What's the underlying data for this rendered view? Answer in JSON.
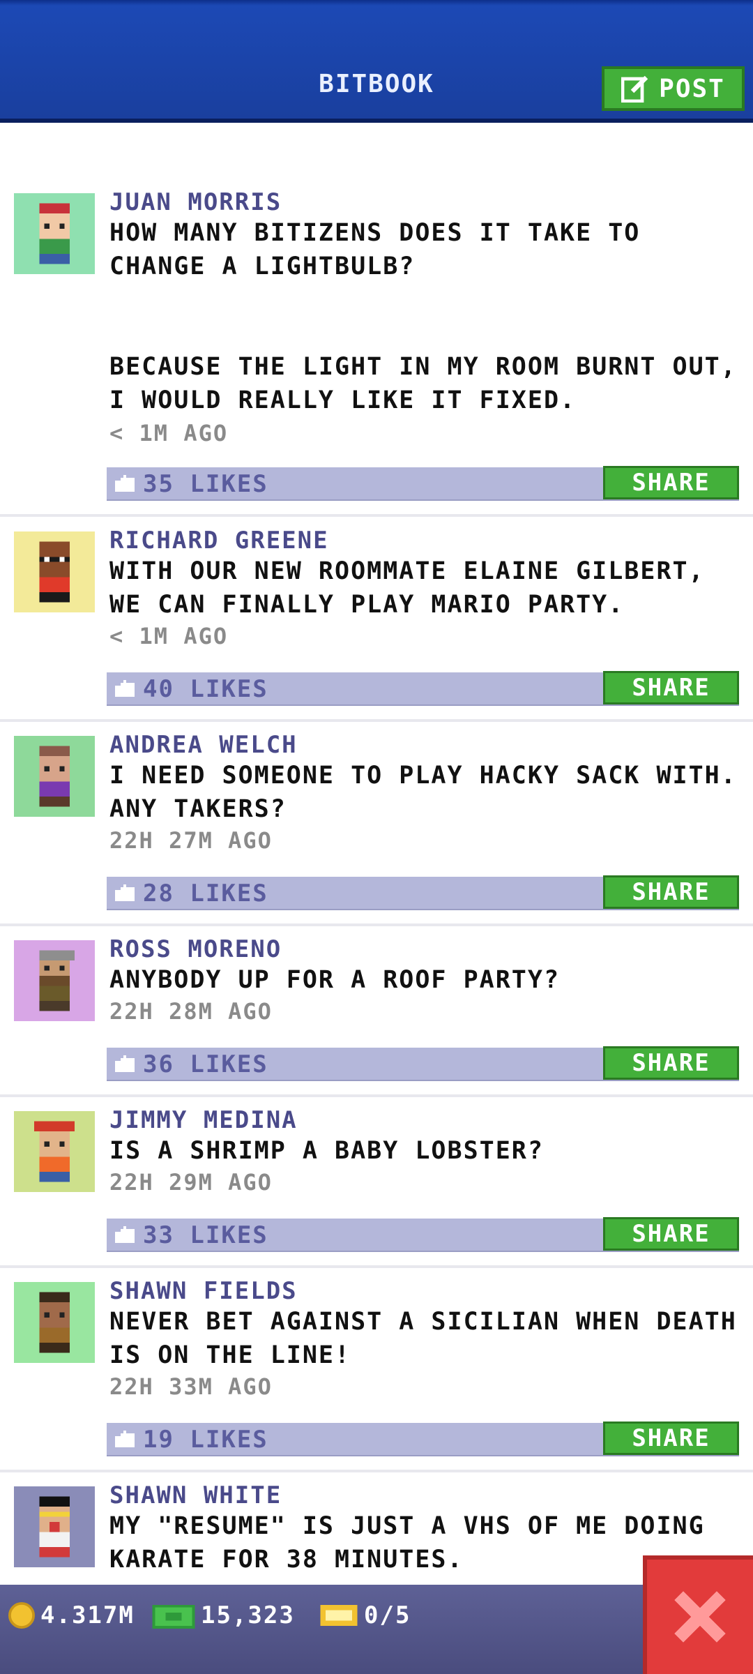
{
  "header": {
    "title": "BITBOOK",
    "post_label": "POST",
    "colors": {
      "bar": "#1a3f9e",
      "post_button": "#43b03a"
    }
  },
  "feed": {
    "share_label": "SHARE",
    "posts": [
      {
        "author": "JUAN MORRIS",
        "message": "HOW MANY BITIZENS DOES IT TAKE TO\nCHANGE A LIGHTBULB?\n\n\nBECAUSE THE LIGHT IN MY ROOM BURNT OUT,\nI WOULD REALLY LIKE IT FIXED.",
        "time": "< 1M AGO",
        "likes": "35 LIKES",
        "avatar_bg": "#8fe0b0",
        "avatar_icon": "bitizen-red-cap-icon"
      },
      {
        "author": "RICHARD GREENE",
        "message": "WITH OUR NEW ROOMMATE ELAINE GILBERT,\nWE CAN FINALLY PLAY MARIO PARTY.",
        "time": "< 1M AGO",
        "likes": "40 LIKES",
        "avatar_bg": "#f3ea99",
        "avatar_icon": "bitizen-mask-icon"
      },
      {
        "author": "ANDREA WELCH",
        "message": "I NEED SOMEONE TO PLAY HACKY SACK WITH.\nANY TAKERS?",
        "time": "22H 27M AGO",
        "likes": "28 LIKES",
        "avatar_bg": "#8ed99a",
        "avatar_icon": "bitizen-purple-shirt-icon"
      },
      {
        "author": "ROSS MORENO",
        "message": "ANYBODY UP FOR A ROOF PARTY?",
        "time": "22H 28M AGO",
        "likes": "36 LIKES",
        "avatar_bg": "#d8a6e6",
        "avatar_icon": "bitizen-grey-cap-icon"
      },
      {
        "author": "JIMMY MEDINA",
        "message": "IS A SHRIMP A BABY LOBSTER?",
        "time": "22H 29M AGO",
        "likes": "33 LIKES",
        "avatar_bg": "#cde08c",
        "avatar_icon": "bitizen-red-cap-icon"
      },
      {
        "author": "SHAWN FIELDS",
        "message": "NEVER BET AGAINST A SICILIAN WHEN DEATH\nIS ON THE LINE!",
        "time": "22H 33M AGO",
        "likes": "19 LIKES",
        "avatar_bg": "#99e6a0",
        "avatar_icon": "bitizen-brown-jacket-icon"
      },
      {
        "author": "SHAWN WHITE",
        "message": "MY \"RESUME\" IS JUST A VHS OF ME DOING\nKARATE FOR 38 MINUTES.",
        "time": "",
        "likes": "",
        "avatar_bg": "#8a8cb8",
        "avatar_icon": "bitizen-sunglasses-icon"
      }
    ]
  },
  "bottom_bar": {
    "coins": "4.317M",
    "bux": "15,323",
    "tickets": "0/5"
  }
}
